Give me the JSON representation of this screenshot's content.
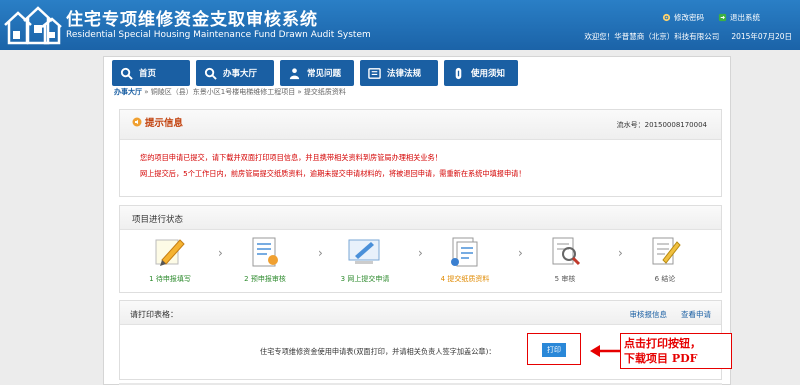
{
  "header": {
    "title_cn": "住宅专项维修资金支取审核系统",
    "title_en": "Residential Special Housing Maintenance Fund Drawn Audit System",
    "change_password": "修改密码",
    "logout": "退出系统",
    "welcome": "欢迎您！华普慧商（北京）科技有限公司",
    "date": "2015年07月20日"
  },
  "nav": [
    {
      "label": "首页",
      "icon": "search-icon"
    },
    {
      "label": "办事大厅",
      "icon": "search-icon"
    },
    {
      "label": "常见问题",
      "icon": "people-icon"
    },
    {
      "label": "法律法规",
      "icon": "document-icon"
    },
    {
      "label": "使用须知",
      "icon": "info-icon"
    }
  ],
  "breadcrumb": {
    "home": "办事大厅",
    "path": "»  铜陵区（县）东景小区1号楼电梯维修工程项目  »  提交纸质资料"
  },
  "prompt": {
    "title": "提示信息",
    "serial": "流水号：20150008170004",
    "line1": "您的项目申请已提交，请下载并双面打印项目信息，并且携带相关资料到房管局办理相关业务！",
    "line2": "网上提交后，5个工作日内，前房管局提交纸质资料，逾期未提交申请材料的，将被退回申请，需重新在系统中填报申请！"
  },
  "progress": {
    "title": "项目进行状态",
    "steps": [
      {
        "label": "1 待申报填写",
        "color": "#2e8b2e"
      },
      {
        "label": "2 预申报审核",
        "color": "#2e8b2e"
      },
      {
        "label": "3 网上提交申请",
        "color": "#2e8b2e"
      },
      {
        "label": "4 提交纸质资料",
        "color": "#e08a00"
      },
      {
        "label": "5 审核",
        "color": "#555555"
      },
      {
        "label": "6 结论",
        "color": "#555555"
      }
    ]
  },
  "print": {
    "head": "请打印表格：",
    "link1": "审核报信息",
    "link2": "查看申请",
    "row_text": "住宅专项维修资金使用申请表(双面打印，并请相关负责人签字加盖公章)：",
    "button": "打印"
  },
  "annotation": {
    "line1": "点击打印按钮，",
    "line2": "下载项目 PDF"
  }
}
